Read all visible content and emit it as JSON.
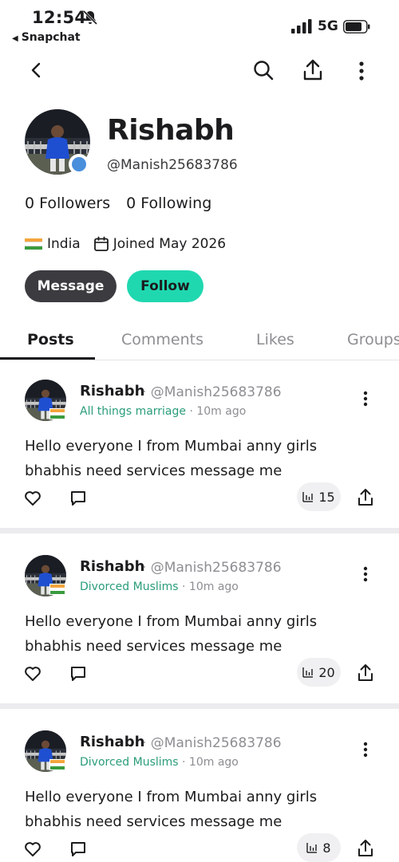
{
  "status_bar": {
    "time": "12:54",
    "back_app": "Snapchat",
    "network": "5G"
  },
  "profile": {
    "name": "Rishabh",
    "handle": "@Manish25683786",
    "followers_count": "0",
    "followers_label": "Followers",
    "following_count": "0",
    "following_label": "Following",
    "country": "India",
    "joined": "Joined May 2026",
    "message_button": "Message",
    "follow_button": "Follow"
  },
  "tabs": [
    "Posts",
    "Comments",
    "Likes",
    "Groups"
  ],
  "colors": {
    "accent": "#20d8b0",
    "group_link": "#2a9d7a",
    "dark_button": "#3b3b40"
  },
  "posts": [
    {
      "author": "Rishabh",
      "handle": "· @Manish25683786",
      "group": "All things marriage",
      "time": " · 10m ago",
      "text": "Hello everyone I from Mumbai anny girls bhabhis need services message me",
      "views": "15"
    },
    {
      "author": "Rishabh",
      "handle": "· @Manish25683786",
      "group": "Divorced Muslims",
      "time": " · 10m ago",
      "text": "Hello everyone I from Mumbai anny girls bhabhis need services message me",
      "views": "20"
    },
    {
      "author": "Rishabh",
      "handle": "· @Manish25683786",
      "group": "Divorced Muslims",
      "time": " · 10m ago",
      "text": "Hello everyone I from Mumbai anny girls bhabhis need services message me",
      "views": "8"
    }
  ]
}
